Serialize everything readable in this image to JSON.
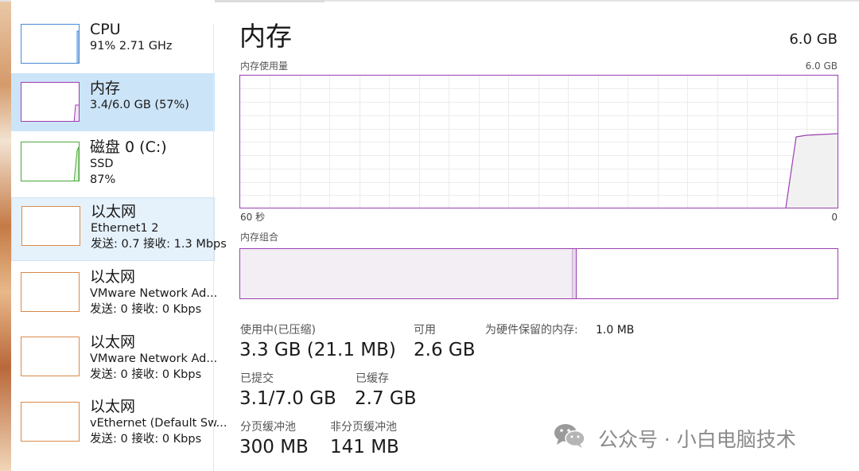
{
  "sidebar": {
    "items": [
      {
        "title": "CPU",
        "line1": "91%  2.71 GHz",
        "line2": ""
      },
      {
        "title": "内存",
        "line1": "3.4/6.0 GB (57%)",
        "line2": ""
      },
      {
        "title": "磁盘 0 (C:)",
        "line1": "SSD",
        "line2": "87%"
      },
      {
        "title": "以太网",
        "line1": "Ethernet1 2",
        "line2": "发送: 0.7  接收: 1.3 Mbps"
      },
      {
        "title": "以太网",
        "line1": "VMware Network Ad...",
        "line2": "发送: 0  接收: 0 Kbps"
      },
      {
        "title": "以太网",
        "line1": "VMware Network Ad...",
        "line2": "发送: 0  接收: 0 Kbps"
      },
      {
        "title": "以太网",
        "line1": "vEthernet (Default Sw...",
        "line2": "发送: 0  接收: 0 Kbps"
      }
    ]
  },
  "main": {
    "title": "内存",
    "total": "6.0 GB",
    "usage_label": "内存使用量",
    "usage_max": "6.0 GB",
    "time_left": "60 秒",
    "time_right": "0",
    "composition_label": "内存组合",
    "stats": {
      "in_use_label": "使用中(已压缩)",
      "in_use_value": "3.3 GB (21.1 MB)",
      "available_label": "可用",
      "available_value": "2.6 GB",
      "reserved_label": "为硬件保留的内存:",
      "reserved_value": "1.0 MB",
      "committed_label": "已提交",
      "committed_value": "3.1/7.0 GB",
      "cached_label": "已缓存",
      "cached_value": "2.7 GB",
      "paged_label": "分页缓冲池",
      "paged_value": "300 MB",
      "nonpaged_label": "非分页缓冲池",
      "nonpaged_value": "141 MB"
    }
  },
  "watermark": {
    "text": "公众号 · 小白电脑技术",
    "icon": "wechat-icon"
  },
  "colors": {
    "memory": "#9b3fb0",
    "cpu": "#4a8bd6",
    "disk": "#4aa83a",
    "ethernet": "#d98a4a",
    "selected": "#cce4f7"
  }
}
